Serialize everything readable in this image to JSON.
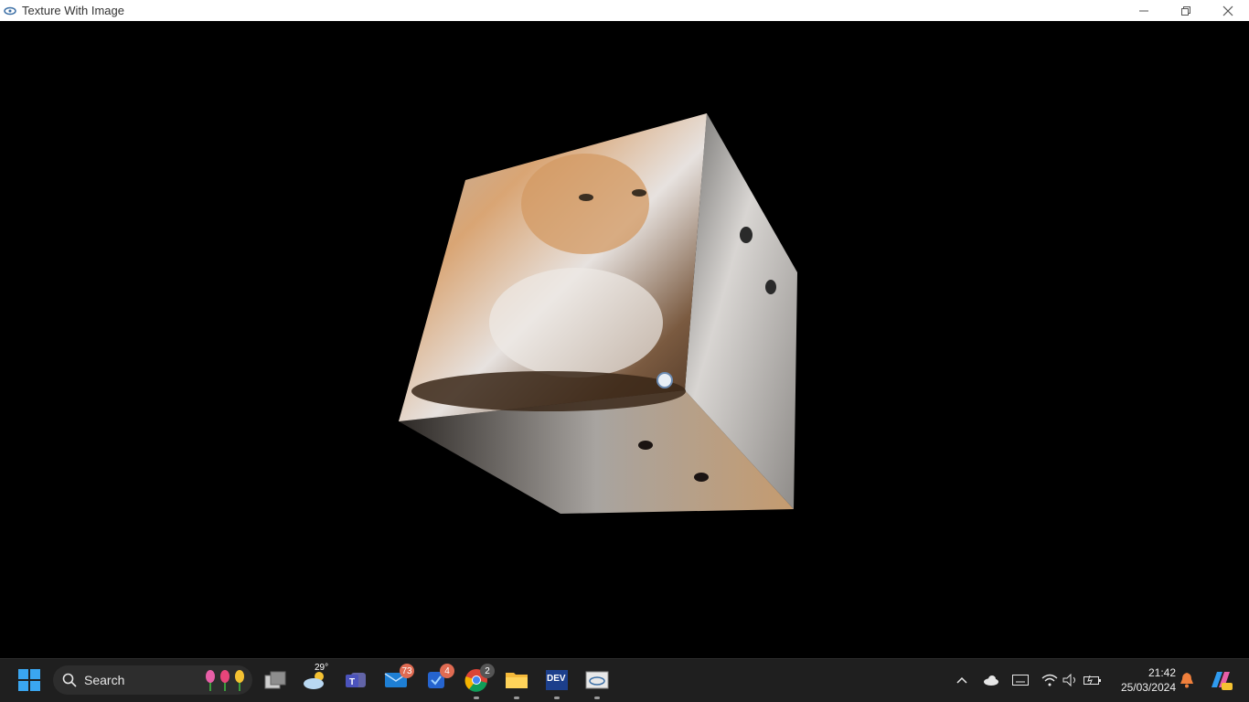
{
  "window": {
    "title": "Texture With Image",
    "minimize_icon": "minimize-icon",
    "restore_icon": "restore-icon",
    "close_icon": "close-icon"
  },
  "scene": {
    "background": "#000000",
    "object": "textured-cube",
    "faces": {
      "front": "orange-cat-eating-texture",
      "right": "white-cat-texture",
      "bottom": "orange-white-kitten-texture"
    }
  },
  "taskbar": {
    "start_icon": "windows-start-icon",
    "search": {
      "label": "Search",
      "icon": "search-icon",
      "decoration": "tulips-icon"
    },
    "weather": {
      "temp": "29°",
      "icon": "weather-cloud-sun-icon"
    },
    "apps": [
      {
        "name": "task-view",
        "badge": ""
      },
      {
        "name": "teams",
        "badge": ""
      },
      {
        "name": "mail",
        "badge": "73"
      },
      {
        "name": "todo",
        "badge": "4"
      },
      {
        "name": "chrome",
        "badge": "2"
      },
      {
        "name": "file-explorer",
        "badge": ""
      },
      {
        "name": "dev",
        "badge": ""
      },
      {
        "name": "opengl-app",
        "badge": ""
      }
    ],
    "dev_label": "DEV",
    "tray": {
      "time": "21:42",
      "date": "25/03/2024"
    }
  }
}
